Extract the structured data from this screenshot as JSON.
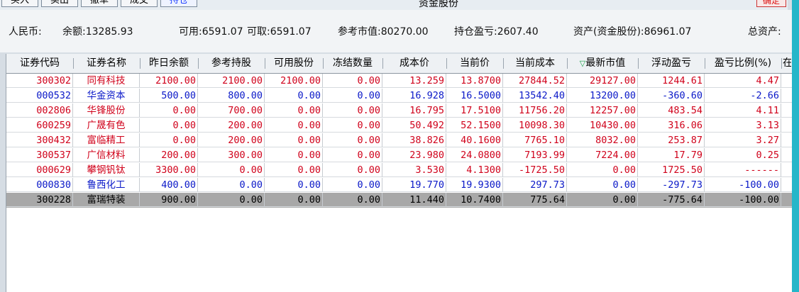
{
  "toolbar": {
    "buttons": [
      "买入",
      "卖出",
      "撤单",
      "成交",
      "持仓"
    ],
    "title": "资金股份",
    "confirm": "确定"
  },
  "summary": {
    "currency": "人民币:",
    "balance": "余额:13285.93",
    "available": "可用:6591.07",
    "withdrawable": "可取:6591.07",
    "ref_market_value": "参考市值:80270.00",
    "position_pnl": "持仓盈亏:2607.40",
    "assets": "资产(资金股份):86961.07",
    "total_assets": "总资产:"
  },
  "table": {
    "columns": [
      "证券代码",
      "证券名称",
      "昨日余额",
      "参考持股",
      "可用股份",
      "冻结数量",
      "成本价",
      "当前价",
      "当前成本",
      "最新市值",
      "浮动盈亏",
      "盈亏比例(%)",
      "在"
    ],
    "sort_indicator": "▽",
    "rows": [
      {
        "code": "300302",
        "name": "同有科技",
        "prev": "2100.00",
        "ref": "2100.00",
        "avail": "2100.00",
        "frozen": "0.00",
        "cost_price": "13.259",
        "cur_price": "13.8700",
        "cur_cost": "27844.52",
        "mkt_value": "29127.00",
        "pnl": "1244.61",
        "pnl_pct": "4.47",
        "color": "red"
      },
      {
        "code": "000532",
        "name": "华金资本",
        "prev": "500.00",
        "ref": "800.00",
        "avail": "0.00",
        "frozen": "0.00",
        "cost_price": "16.928",
        "cur_price": "16.5000",
        "cur_cost": "13542.40",
        "mkt_value": "13200.00",
        "pnl": "-360.60",
        "pnl_pct": "-2.66",
        "color": "blue"
      },
      {
        "code": "002806",
        "name": "华锋股份",
        "prev": "0.00",
        "ref": "700.00",
        "avail": "0.00",
        "frozen": "0.00",
        "cost_price": "16.795",
        "cur_price": "17.5100",
        "cur_cost": "11756.20",
        "mkt_value": "12257.00",
        "pnl": "483.54",
        "pnl_pct": "4.11",
        "color": "red"
      },
      {
        "code": "600259",
        "name": "广晟有色",
        "prev": "0.00",
        "ref": "200.00",
        "avail": "0.00",
        "frozen": "0.00",
        "cost_price": "50.492",
        "cur_price": "52.1500",
        "cur_cost": "10098.30",
        "mkt_value": "10430.00",
        "pnl": "316.06",
        "pnl_pct": "3.13",
        "color": "red"
      },
      {
        "code": "300432",
        "name": "富临精工",
        "prev": "0.00",
        "ref": "200.00",
        "avail": "0.00",
        "frozen": "0.00",
        "cost_price": "38.826",
        "cur_price": "40.1600",
        "cur_cost": "7765.10",
        "mkt_value": "8032.00",
        "pnl": "253.87",
        "pnl_pct": "3.27",
        "color": "red"
      },
      {
        "code": "300537",
        "name": "广信材料",
        "prev": "200.00",
        "ref": "300.00",
        "avail": "0.00",
        "frozen": "0.00",
        "cost_price": "23.980",
        "cur_price": "24.0800",
        "cur_cost": "7193.99",
        "mkt_value": "7224.00",
        "pnl": "17.79",
        "pnl_pct": "0.25",
        "color": "red"
      },
      {
        "code": "000629",
        "name": "攀钢钒钛",
        "prev": "3300.00",
        "ref": "0.00",
        "avail": "0.00",
        "frozen": "0.00",
        "cost_price": "3.530",
        "cur_price": "4.1300",
        "cur_cost": "-1725.50",
        "mkt_value": "0.00",
        "pnl": "1725.50",
        "pnl_pct": "------",
        "color": "red"
      },
      {
        "code": "000830",
        "name": "鲁西化工",
        "prev": "400.00",
        "ref": "0.00",
        "avail": "0.00",
        "frozen": "0.00",
        "cost_price": "19.770",
        "cur_price": "19.9300",
        "cur_cost": "297.73",
        "mkt_value": "0.00",
        "pnl": "-297.73",
        "pnl_pct": "-100.00",
        "color": "blue"
      },
      {
        "code": "300228",
        "name": "富瑞特装",
        "prev": "900.00",
        "ref": "0.00",
        "avail": "0.00",
        "frozen": "0.00",
        "cost_price": "11.440",
        "cur_price": "10.7400",
        "cur_cost": "775.64",
        "mkt_value": "0.00",
        "pnl": "-775.64",
        "pnl_pct": "-100.00",
        "color": "black",
        "selected": true
      }
    ]
  },
  "colors": {
    "positive": "#d0021b",
    "negative": "#0a18c8",
    "selected_row": "#a8a8a8",
    "accent_bar": "#25b6c9"
  }
}
